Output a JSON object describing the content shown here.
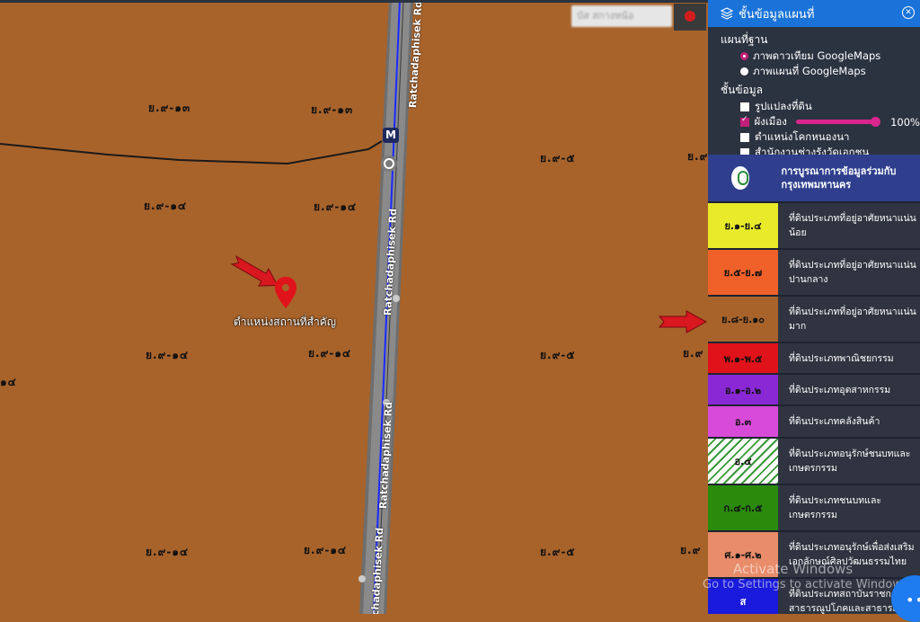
{
  "map": {
    "road_name": "Ratchadaphisek Rd",
    "metro_icon": "M",
    "place_label": "ตำแหน่งสถานที่สำคัญ",
    "search_placeholder": "บัส สกางหน้อ",
    "zone_labels": [
      "ย.๙-๑๓",
      "ย.๙-๑๓",
      "ย.๙-๕",
      "ย.๙",
      "ย.๙-๑๔",
      "ย.๙-๑๔",
      "ย.๙-๑๔",
      "ย.๙-๑๔",
      "ย.๙-๕",
      "ย.๙",
      "๑๔",
      "ย.๙-๑๔",
      "ย.๙-๑๔",
      "ย.๙-๕",
      "ย.๙"
    ]
  },
  "panel": {
    "title": "ชั้นข้อมูลแผนที่",
    "basemap_heading": "แผนที่ฐาน",
    "basemap_options": [
      {
        "label": "ภาพดาวเทียม GoogleMaps",
        "selected": true
      },
      {
        "label": "ภาพแผนที่ GoogleMaps",
        "selected": false
      }
    ],
    "layers_heading": "ชั้นข้อมูล",
    "layers": [
      {
        "label": "รูปแปลงที่ดิน",
        "checked": false
      },
      {
        "label": "ผังเมือง",
        "checked": true,
        "opacity": "100%"
      },
      {
        "label": "ตำแหน่งโคกหนองนา",
        "checked": false
      },
      {
        "label": "สำนักงานช่างรังวัดเอกชน",
        "checked": false
      }
    ],
    "bma_text": "การบูรณาการข้อมูลร่วมกับกรุงเทพมหานคร",
    "legend": [
      {
        "code": "ย.๑-ย.๔",
        "desc": "ที่ดินประเภทที่อยู่อาศัยหนาแน่นน้อย",
        "color": "#e8ea2a"
      },
      {
        "code": "ย.๕-ย.๗",
        "desc": "ที่ดินประเภทที่อยู่อาศัยหนาแน่นปานกลาง",
        "color": "#f0612a"
      },
      {
        "code": "ย.๘-ย.๑๐",
        "desc": "ที่ดินประเภทที่อยู่อาศัยหนาแน่นมาก",
        "color": "#a8632b"
      },
      {
        "code": "พ.๑-พ.๕",
        "desc": "ที่ดินประเภทพาณิชยกรรม",
        "color": "#e0121a"
      },
      {
        "code": "อ.๑-อ.๒",
        "desc": "ที่ดินประเภทอุตสาหกรรม",
        "color": "#8a28d6"
      },
      {
        "code": "อ.๓",
        "desc": "ที่ดินประเภทคลังสินค้า",
        "color": "#d84bd8"
      },
      {
        "code": "อ.๔",
        "desc": "ที่ดินประเภทอนุรักษ์ชนบทและเกษตรกรรม",
        "color": "#ffffff"
      },
      {
        "code": "ก.๔-ก.๕",
        "desc": "ที่ดินประเภทชนบทและเกษตรกรรม",
        "color": "#2a8a0c"
      },
      {
        "code": "ศ.๑-ศ.๒",
        "desc": "ที่ดินประเภทอนุรักษ์เพื่อส่งเสริมเอกลักษณ์ศิลปวัฒนธรรมไทย",
        "color": "#e88c6a"
      },
      {
        "code": "ส",
        "desc": "ที่ดินประเภทสถาบันราชการ สาธารณูปโภคและสาธารณู",
        "color": "#1a1adc"
      }
    ]
  },
  "watermark": {
    "line1": "Activate Windows",
    "line2": "Go to Settings to activate Windows."
  }
}
